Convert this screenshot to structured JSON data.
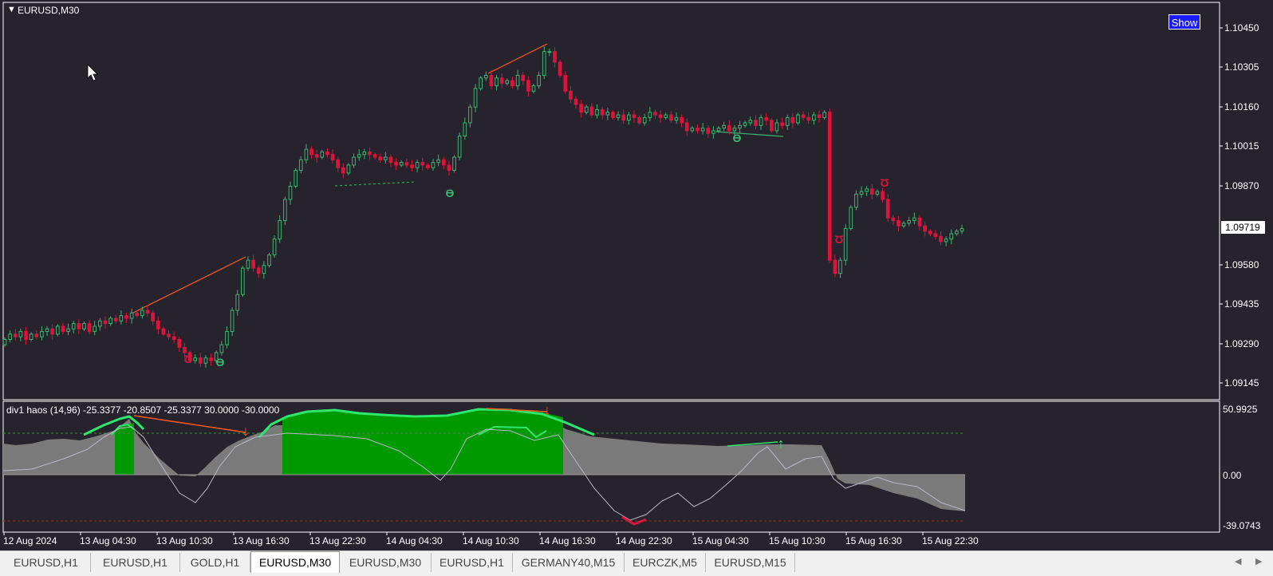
{
  "main_chart": {
    "symbol_label": "EURUSD,M30",
    "current_price": "1.09719",
    "price_ticks": [
      "1.10450",
      "1.10305",
      "1.10160",
      "1.10015",
      "1.09870",
      "1.09580",
      "1.09435",
      "1.09290",
      "1.09145"
    ],
    "show_button": "Show"
  },
  "indicator": {
    "title": "div1 haos  (14,96) -25.3377 -20.8507 -25.3377 30.0000 -30.0000",
    "ticks": [
      "50.9925",
      "0.00",
      "-39.0743"
    ]
  },
  "time_axis": [
    "12 Aug 2024",
    "13 Aug 04:30",
    "13 Aug 10:30",
    "13 Aug 16:30",
    "13 Aug 22:30",
    "14 Aug 04:30",
    "14 Aug 10:30",
    "14 Aug 16:30",
    "14 Aug 22:30",
    "15 Aug 04:30",
    "15 Aug 10:30",
    "15 Aug 16:30",
    "15 Aug 22:30"
  ],
  "tabs": [
    {
      "label": "EURUSD,H1",
      "active": false
    },
    {
      "label": "EURUSD,H1",
      "active": false
    },
    {
      "label": "GOLD,H1",
      "active": false
    },
    {
      "label": "EURUSD,M30",
      "active": true
    },
    {
      "label": "EURUSD,M30",
      "active": false
    },
    {
      "label": "EURUSD,H1",
      "active": false
    },
    {
      "label": "GERMANY40,M15",
      "active": false
    },
    {
      "label": "EURCZK,M5",
      "active": false
    },
    {
      "label": "EURUSD,M15",
      "active": false
    }
  ],
  "colors": {
    "background": "#27232d",
    "bull": "#3cb371",
    "bear": "#dc143c",
    "histogram_gray": "#7a7a7a",
    "histogram_green": "#009900",
    "signal_line": "#2ee86e",
    "divergence_line": "#ff5a1e"
  },
  "chart_data": {
    "type": "candlestick",
    "price_range": [
      1.0909,
      1.1057
    ],
    "close_series": [
      1.093,
      1.0932,
      1.0931,
      1.0933,
      1.093,
      1.0932,
      1.0931,
      1.0933,
      1.0934,
      1.0932,
      1.0935,
      1.0933,
      1.0934,
      1.0936,
      1.0934,
      1.0936,
      1.0933,
      1.0935,
      1.0937,
      1.0936,
      1.0938,
      1.0937,
      1.0939,
      1.0938,
      1.094,
      1.0939,
      1.0941,
      1.094,
      1.0937,
      1.0934,
      1.0932,
      1.0931,
      1.093,
      1.0927,
      1.0925,
      1.0922,
      1.0923,
      1.0921,
      1.0923,
      1.0922,
      1.0925,
      1.0928,
      1.0933,
      1.0941,
      1.0947,
      1.0957,
      1.096,
      1.0957,
      1.0955,
      1.0958,
      1.0962,
      1.0968,
      1.0975,
      1.0983,
      1.0988,
      1.0994,
      1.0998,
      1.1002,
      1.1,
      1.0999,
      1.1001,
      1.1,
      1.0998,
      1.0995,
      1.0993,
      1.0996,
      1.0999,
      1.1,
      1.1001,
      1.1,
      1.0999,
      1.0998,
      1.0999,
      1.0997,
      1.0996,
      1.0997,
      1.0996,
      1.0995,
      1.0997,
      1.0996,
      1.0995,
      1.0997,
      1.0998,
      1.0996,
      1.0994,
      1.0999,
      1.1007,
      1.1012,
      1.1018,
      1.1025,
      1.1029,
      1.103,
      1.1026,
      1.1029,
      1.1027,
      1.1028,
      1.1026,
      1.103,
      1.1028,
      1.1024,
      1.1026,
      1.103,
      1.1039,
      1.1039,
      1.1035,
      1.103,
      1.1024,
      1.1021,
      1.1019,
      1.1016,
      1.1018,
      1.1015,
      1.1017,
      1.1015,
      1.1016,
      1.1014,
      1.1015,
      1.1013,
      1.1015,
      1.1014,
      1.1012,
      1.1014,
      1.1016,
      1.1015,
      1.1014,
      1.1015,
      1.1013,
      1.1014,
      1.1012,
      1.1009,
      1.101,
      1.1009,
      1.101,
      1.1008,
      1.1009,
      1.101,
      1.1011,
      1.1009,
      1.101,
      1.1011,
      1.1012,
      1.1013,
      1.1011,
      1.1014,
      1.1013,
      1.1009,
      1.1012,
      1.1011,
      1.1014,
      1.1012,
      1.1015,
      1.1014,
      1.1013,
      1.1015,
      1.1014,
      1.1016,
      1.096,
      1.0955,
      1.096,
      1.0972,
      1.098,
      1.0985,
      1.0986,
      1.0987,
      1.0985,
      1.0986,
      1.0983,
      1.0976,
      1.0975,
      1.0973,
      1.0974,
      1.0975,
      1.0976,
      1.0973,
      1.0971,
      1.097,
      1.0969,
      1.0967,
      1.0968,
      1.097,
      1.0971,
      1.0972
    ]
  }
}
